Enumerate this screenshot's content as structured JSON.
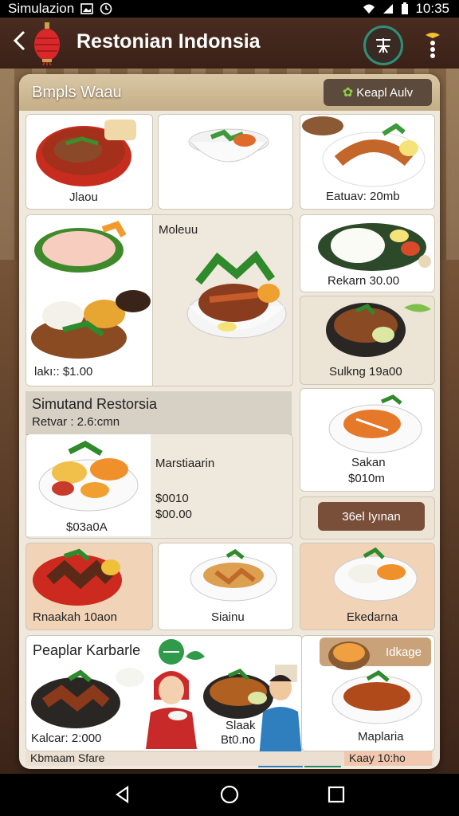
{
  "status": {
    "left_text": "Simulazion",
    "time": "10:35"
  },
  "header": {
    "title": "Restonian Indonsia",
    "back_icon": "back-arrow-icon",
    "accent": "#2f8f79"
  },
  "panel": {
    "title": "Bmpls Waau",
    "button": "Keapl Aulv"
  },
  "cards": {
    "c1": "Jlaou",
    "c3": "Eatuav: 20mb",
    "c4_name": "Moleuu",
    "c4_price": "lakı:: $1.00",
    "c6": "Rekarn 30.00",
    "c7": "Sulkng 19a00",
    "sec_title": "Simutand Restorsia",
    "sec_sub": "Retvar : 2.6:cmn",
    "c8_name": "Marstiaarin",
    "c8_price1": "$0010",
    "c8_price2": "$00.00",
    "c8_left_price": "$03a0A",
    "c9_name": "Sakan",
    "c9_price": "$010m",
    "c10_button": "36el Iyınan",
    "c11": "Rnaakah 10aon",
    "c12": "Siainu",
    "c13": "Ekedarna",
    "promo_title": "Peaplar Karbarle",
    "promo_badge": "Idkage",
    "promo_left": "Kalcar: 2:000",
    "promo_mid_name": "Slaak",
    "promo_mid_price": "Bt0.no",
    "promo_right": "Maplaria",
    "footer_left": "Kbmaam Sfare",
    "footer_right": "Kaay 10:ho"
  },
  "nav": {
    "back": "back-triangle-icon",
    "home": "home-circle-icon",
    "recents": "recents-square-icon"
  }
}
